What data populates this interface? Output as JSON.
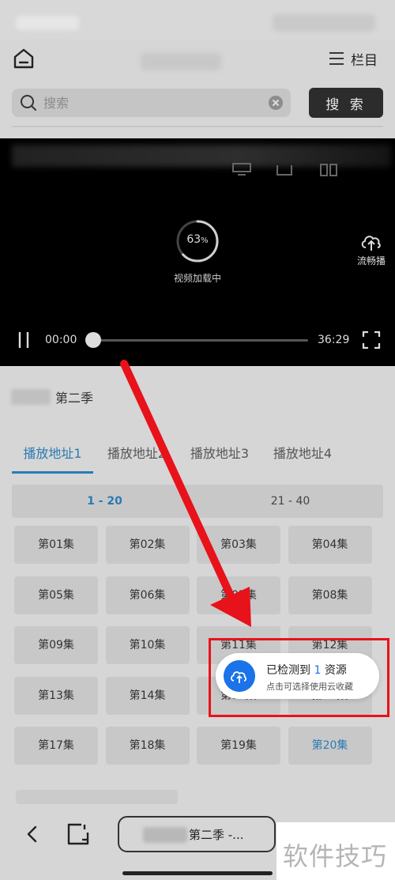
{
  "header": {
    "menu_label": "栏目"
  },
  "search": {
    "placeholder": "搜索",
    "button_label": "搜 索"
  },
  "player": {
    "loading_percent": "63",
    "loading_percent_unit": "%",
    "loading_label": "视频加载中",
    "smooth_label": "流畅播",
    "time_current": "00:00",
    "time_total": "36:29",
    "progress": 0,
    "loading_progress": 0.63
  },
  "show": {
    "title": "第二季"
  },
  "tabs": [
    "播放地址1",
    "播放地址2",
    "播放地址3",
    "播放地址4"
  ],
  "active_tab": 0,
  "ranges": [
    "1 - 20",
    "21 - 40"
  ],
  "active_range": 0,
  "episodes": [
    "第01集",
    "第02集",
    "第03集",
    "第04集",
    "第05集",
    "第06集",
    "第07集",
    "第08集",
    "第09集",
    "第10集",
    "第11集",
    "第12集",
    "第13集",
    "第14集",
    "第15集",
    "第16集",
    "第17集",
    "第18集",
    "第19集",
    "第20集"
  ],
  "active_episode": 19,
  "toast": {
    "title_prefix": "已检测到 ",
    "count": "1",
    "title_suffix": " 资源",
    "subtitle": "点击可选择使用云收藏"
  },
  "bottom": {
    "url_text": "第二季 -..."
  },
  "watermark": "软件技巧",
  "colors": {
    "accent": "#2a7bb3",
    "toast_icon": "#1a73e8",
    "highlight": "#e8121b",
    "arrow": "#e8121b"
  }
}
